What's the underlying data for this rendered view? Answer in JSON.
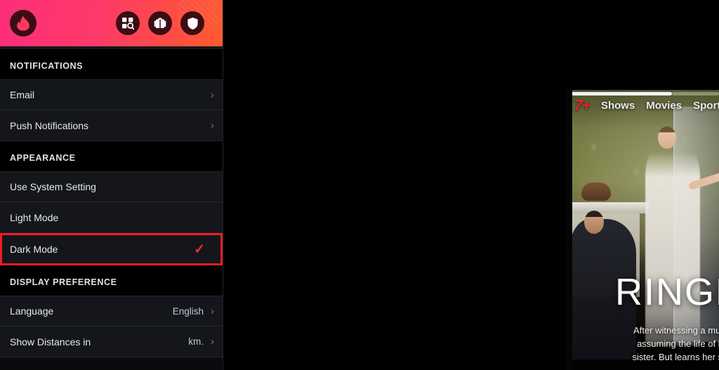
{
  "tinder": {
    "header": {
      "logo_icon": "tinder-flame-icon",
      "actions": [
        {
          "name": "explore-search-icon",
          "label": "Explore"
        },
        {
          "name": "briefcase-icon",
          "label": "Passport"
        },
        {
          "name": "shield-icon",
          "label": "Safety"
        }
      ]
    },
    "sections": [
      {
        "title": "NOTIFICATIONS",
        "rows": [
          {
            "label": "Email",
            "value": "",
            "chevron": "›",
            "highlighted": false,
            "checked": false
          },
          {
            "label": "Push Notifications",
            "value": "",
            "chevron": "›",
            "highlighted": false,
            "checked": false
          }
        ]
      },
      {
        "title": "APPEARANCE",
        "rows": [
          {
            "label": "Use System Setting",
            "value": "",
            "chevron": "",
            "highlighted": false,
            "checked": false
          },
          {
            "label": "Light Mode",
            "value": "",
            "chevron": "",
            "highlighted": false,
            "checked": false
          },
          {
            "label": "Dark Mode",
            "value": "",
            "chevron": "",
            "highlighted": true,
            "checked": true,
            "check_glyph": "✓"
          }
        ]
      },
      {
        "title": "DISPLAY PREFERENCE",
        "rows": [
          {
            "label": "Language",
            "value": "English",
            "chevron": "›",
            "highlighted": false,
            "checked": false
          },
          {
            "label": "Show Distances in",
            "value": "km.",
            "chevron": "›",
            "highlighted": false,
            "checked": false
          }
        ]
      }
    ]
  },
  "seven_plus": {
    "logo_text": "7+",
    "nav": [
      "Shows",
      "Movies",
      "Sport"
    ],
    "carousel": {
      "segments": 2,
      "active_index": 0
    },
    "hero": {
      "title": "RINGER",
      "description": "After witnessing a murder, Bridget g\nassuming the life of her wealthy id\nsister. But learns her sister's life is ju"
    }
  },
  "colors": {
    "tinder_gradient_start": "#fd2d7b",
    "tinder_gradient_end": "#ff5b2e",
    "highlight_border": "#ee1c25",
    "check_red": "#e8313b",
    "row_background": "#14161b",
    "section_background": "#000000",
    "seven_logo_red": "#e6242c"
  }
}
